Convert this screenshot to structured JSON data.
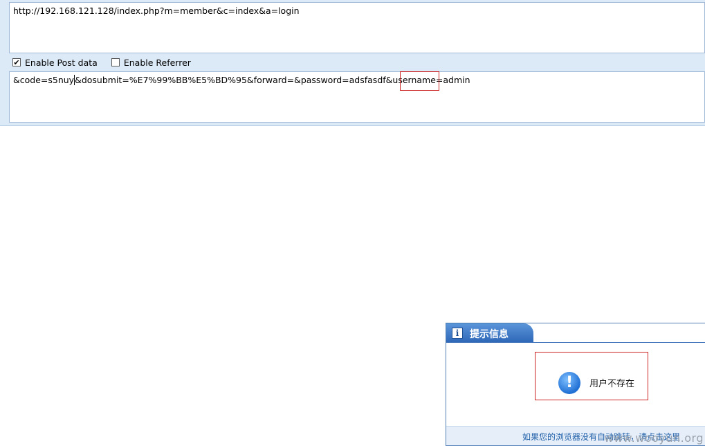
{
  "hackbar": {
    "url": "http://192.168.121.128/index.php?m=member&c=index&a=login",
    "enable_post_label": "Enable Post data",
    "enable_post_checked": "✔",
    "enable_referrer_label": "Enable Referrer",
    "post_before_caret": "&code=s5nuy",
    "post_after_caret": "&dosubmit=%E7%99%BB%E5%BD%95&forward=&password=adsfasdf&username=admin"
  },
  "dialog": {
    "title": "提示信息",
    "info_glyph": "i",
    "alert_glyph": "!",
    "message": "用户不存在",
    "redirect_link": "如果您的浏览器没有自动跳转，请点击这里"
  },
  "watermark": "www.wooyun.org",
  "colors": {
    "accent": "#2f68b8",
    "highlight": "#cc2222",
    "hackbar_bg": "#dce9f7"
  }
}
